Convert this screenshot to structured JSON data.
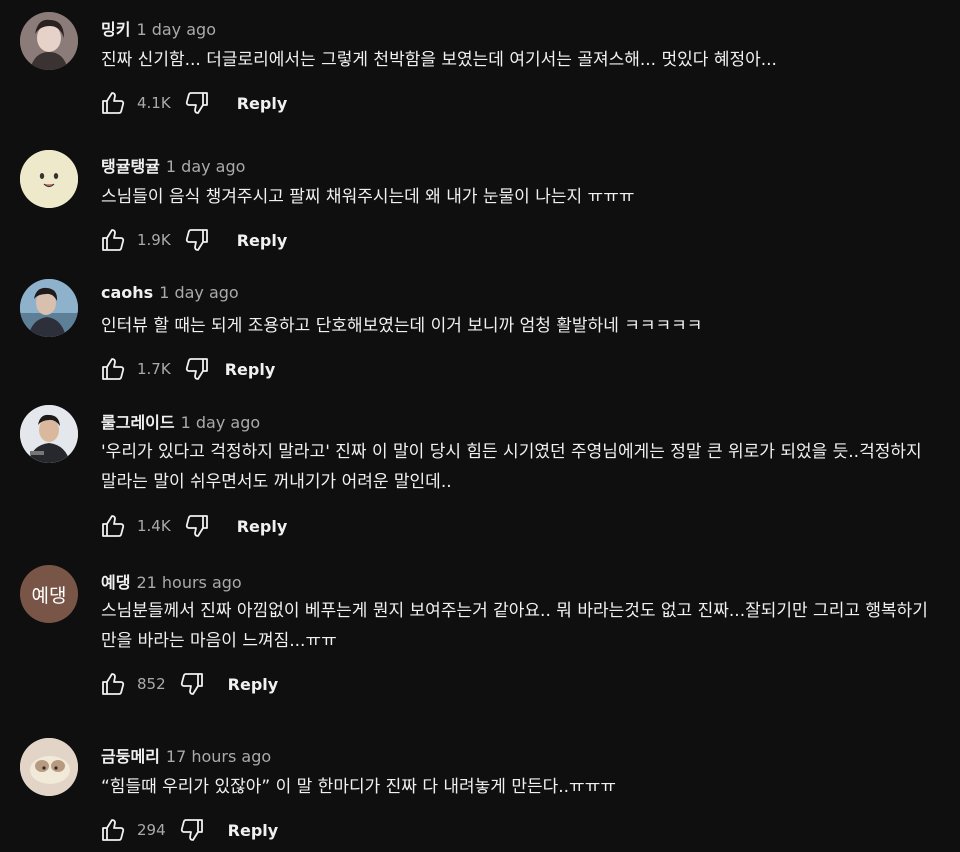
{
  "labels": {
    "reply": "Reply"
  },
  "comments": [
    {
      "author": "밍키",
      "time": "1 day ago",
      "text": "진짜 신기함... 더글로리에서는 그렇게 천박함을 보였는데 여기서는 골져스해... 멋있다 혜정아...",
      "likes": "4.1K"
    },
    {
      "author": "탱귤탱귤",
      "time": "1 day ago",
      "text": "스님들이 음식 챙겨주시고 팔찌 채워주시는데 왜 내가 눈물이 나는지 ㅠㅠㅠ",
      "likes": "1.9K"
    },
    {
      "author": "caohs",
      "time": "1 day ago",
      "text": "인터뷰 할 때는 되게 조용하고 단호해보였는데 이거 보니까 엄청 활발하네 ㅋㅋㅋㅋㅋ",
      "likes": "1.7K"
    },
    {
      "author": "룰그레이드",
      "time": "1 day ago",
      "text": "'우리가 있다고 걱정하지 말라고' 진짜 이 말이 당시 힘든 시기였던 주영님에게는 정말 큰 위로가 되었을 듯..걱정하지 말라는 말이 쉬우면서도 꺼내기가 어려운 말인데..",
      "likes": "1.4K"
    },
    {
      "author": "예댕",
      "time": "21 hours ago",
      "text": "스님분들께서 진짜 아낌없이 베푸는게 뭔지 보여주는거 같아요.. 뭐 바라는것도 없고 진짜...잘되기만 그리고 행복하기만을 바라는 마음이 느껴짐...ㅠㅠ",
      "likes": "852",
      "avatar_text": "예댕"
    },
    {
      "author": "금둥메리",
      "time": "17 hours ago",
      "text": "“힘들때 우리가 있잖아” 이 말 한마디가 진짜 다 내려놓게 만든다..ㅠㅠㅠ",
      "likes": "294"
    }
  ]
}
